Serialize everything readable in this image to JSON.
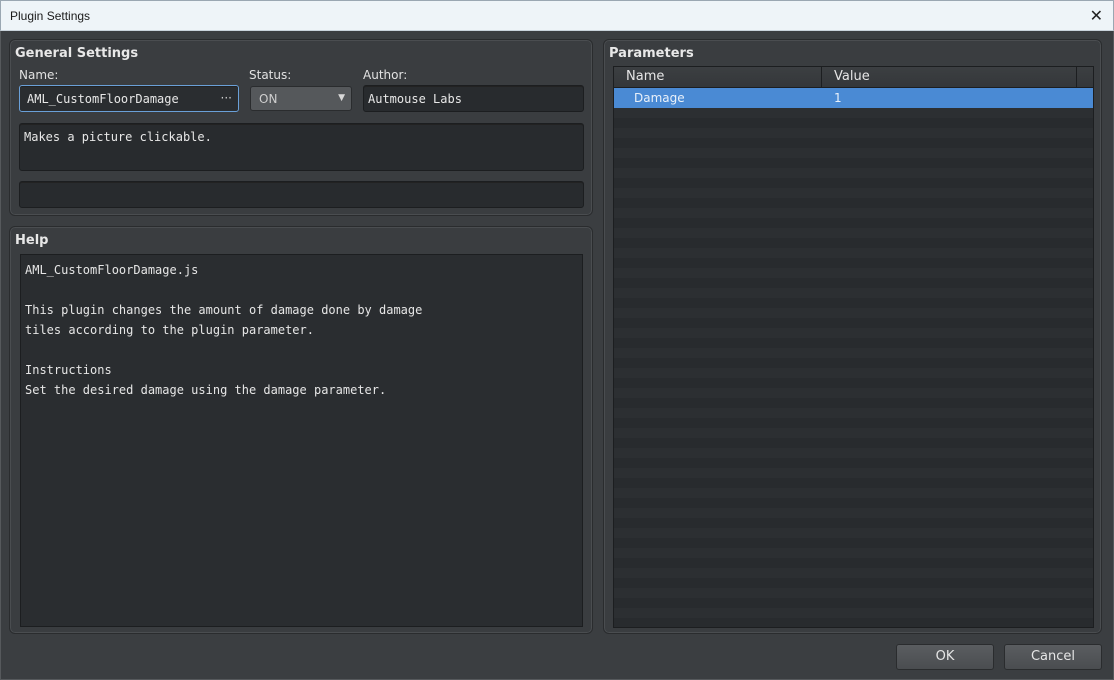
{
  "window": {
    "title": "Plugin Settings",
    "close_glyph": "✕"
  },
  "general": {
    "section_title": "General Settings",
    "name_label": "Name:",
    "name_value": "AML_CustomFloorDamage",
    "name_more": "···",
    "status_label": "Status:",
    "status_value": "ON",
    "status_arrow": "▼",
    "author_label": "Author:",
    "author_value": "Autmouse Labs",
    "description": "Makes a picture clickable.",
    "extra_field": ""
  },
  "help": {
    "section_title": "Help",
    "text": "AML_CustomFloorDamage.js\n\nThis plugin changes the amount of damage done by damage\ntiles according to the plugin parameter.\n\nInstructions\nSet the desired damage using the damage parameter."
  },
  "parameters": {
    "section_title": "Parameters",
    "columns": [
      "Name",
      "Value"
    ],
    "rows": [
      {
        "name": "Damage",
        "value": "1"
      }
    ]
  },
  "buttons": {
    "ok": "OK",
    "cancel": "Cancel"
  },
  "colors": {
    "accent": "#4a8ad4",
    "panel": "#3a3d40",
    "field": "#282b2e"
  }
}
